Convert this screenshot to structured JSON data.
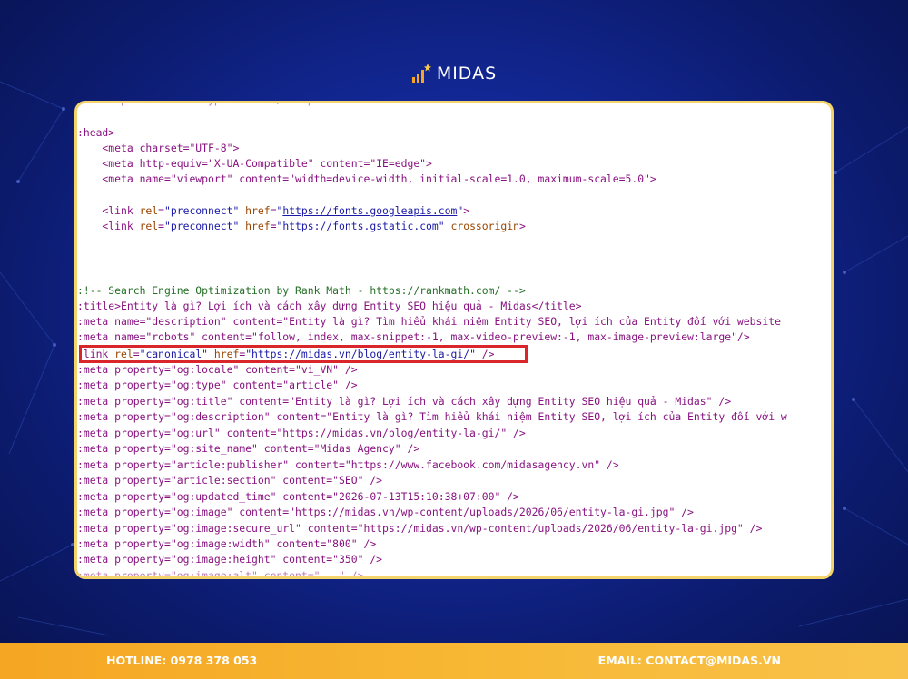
{
  "brand": {
    "name": "MIDAS",
    "icon": "bar-chart-star-icon"
  },
  "colors": {
    "background": "#13299a",
    "card_border": "#f3d36a",
    "highlight_border": "#d8262b",
    "footer": "#f5a623",
    "tag": "#881280",
    "attr": "#994500",
    "value": "#1a1aa6",
    "comment": "#236e25"
  },
  "code_lines": {
    "l1": ":head>",
    "l2": "    <meta charset=\"UTF-8\">",
    "l3": "    <meta http-equiv=\"X-UA-Compatible\" content=\"IE=edge\">",
    "l4": "    <meta name=\"viewport\" content=\"width=device-width, initial-scale=1.0, maximum-scale=5.0\">",
    "l5": "    <link rel=\"preconnect\" href=\"https://fonts.googleapis.com\">",
    "l6": "    <link rel=\"preconnect\" href=\"https://fonts.gstatic.com\" crossorigin>",
    "l7": ":!-- Search Engine Optimization by Rank Math - https://rankmath.com/ -->",
    "l8": ":title>Entity là gì? Lợi ích và cách xây dựng Entity SEO hiệu quả - Midas</title>",
    "l9": ":meta name=\"description\" content=\"Entity là gì? Tìm hiểu khái niệm Entity SEO, lợi ích của Entity đối với website",
    "l10": ":meta name=\"robots\" content=\"follow, index, max-snippet:-1, max-video-preview:-1, max-image-preview:large\"/>",
    "l11": ":link rel=\"canonical\" href=\"https://midas.vn/blog/entity-la-gi/\" />",
    "l12": ":meta property=\"og:locale\" content=\"vi_VN\" />",
    "l13": ":meta property=\"og:type\" content=\"article\" />",
    "l14": ":meta property=\"og:title\" content=\"Entity là gì? Lợi ích và cách xây dựng Entity SEO hiệu quả - Midas\" />",
    "l15": ":meta property=\"og:description\" content=\"Entity là gì? Tìm hiểu khái niệm Entity SEO, lợi ích của Entity đối với w",
    "l16": ":meta property=\"og:url\" content=\"https://midas.vn/blog/entity-la-gi/\" />",
    "l17": ":meta property=\"og:site_name\" content=\"Midas Agency\" />",
    "l18": ":meta property=\"article:publisher\" content=\"https://www.facebook.com/midasagency.vn\" />",
    "l19": ":meta property=\"article:section\" content=\"SEO\" />",
    "l20": ":meta property=\"og:updated_time\" content=\"2026-07-13T15:10:38+07:00\" />",
    "l21": ":meta property=\"og:image\" content=\"https://midas.vn/wp-content/uploads/2026/06/entity-la-gi.jpg\" />",
    "l22": ":meta property=\"og:image:secure_url\" content=\"https://midas.vn/wp-content/uploads/2026/06/entity-la-gi.jpg\" />",
    "l23": ":meta property=\"og:image:width\" content=\"800\" />",
    "l24": ":meta property=\"og:image:height\" content=\"350\" />"
  },
  "tokens": {
    "preconnect_href_1": "https://fonts.googleapis.com",
    "preconnect_href_2": "https://fonts.gstatic.com",
    "canonical_href": "https://midas.vn/blog/entity-la-gi/"
  },
  "footer": {
    "hotline": "HOTLINE: 0978 378 053",
    "email": "EMAIL: CONTACT@MIDAS.VN"
  }
}
